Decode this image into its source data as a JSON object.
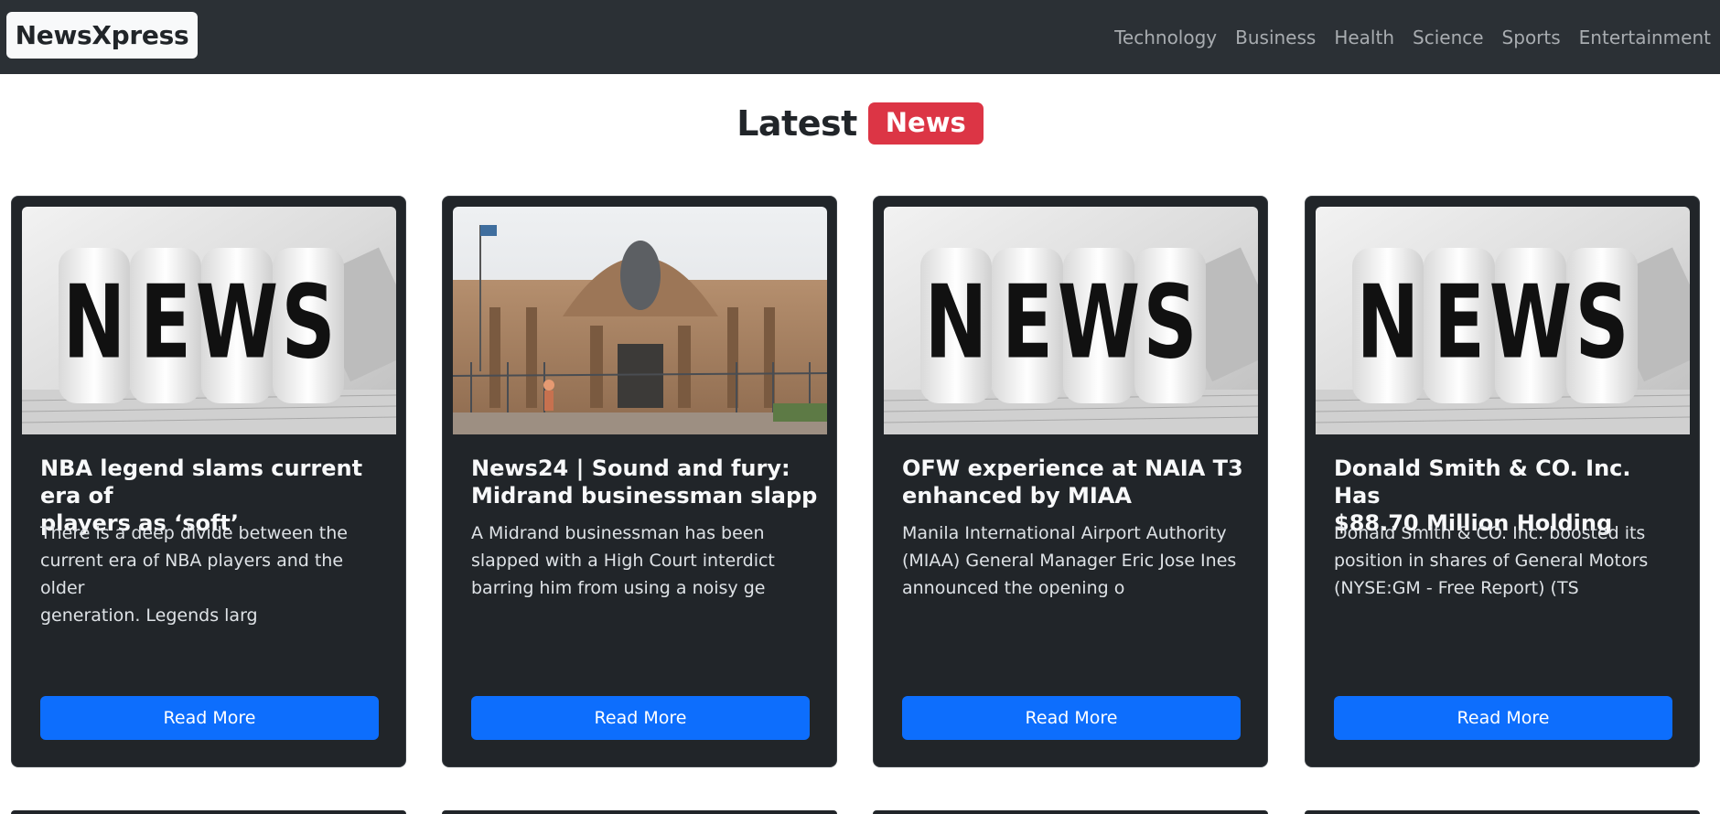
{
  "navbar": {
    "brand": "NewsXpress",
    "links": [
      "Technology",
      "Business",
      "Health",
      "Science",
      "Sports",
      "Entertainment"
    ]
  },
  "heading": {
    "text": "Latest",
    "badge": "News"
  },
  "colors": {
    "navbar_bg": "#2b3035",
    "card_bg": "#212529",
    "badge": "#dc3545",
    "button": "#0d6efd"
  },
  "cards": [
    {
      "image": "news-dice-image",
      "title": "NBA legend slams current era of\nplayers as ‘soft’",
      "description": "There is a deep divide between the\ncurrent era of NBA players and the older\ngeneration. Legends larg",
      "button": "Read More"
    },
    {
      "image": "courthouse-photo",
      "title": "News24 | Sound and fury:\nMidrand businessman slapp",
      "description": "A Midrand businessman has been\nslapped with a High Court interdict\nbarring him from using a noisy ge",
      "button": "Read More"
    },
    {
      "image": "news-dice-image",
      "title": "OFW experience at NAIA T3\nenhanced by MIAA",
      "description": "Manila International Airport Authority\n(MIAA) General Manager Eric Jose Ines\nannounced the opening o",
      "button": "Read More"
    },
    {
      "image": "news-dice-image",
      "title": "Donald Smith & CO. Inc. Has\n$88.70 Million Holding",
      "description": "Donald Smith & CO. Inc. boosted its\nposition in shares of General Motors\n(NYSE:GM - Free Report) (TS",
      "button": "Read More"
    }
  ]
}
